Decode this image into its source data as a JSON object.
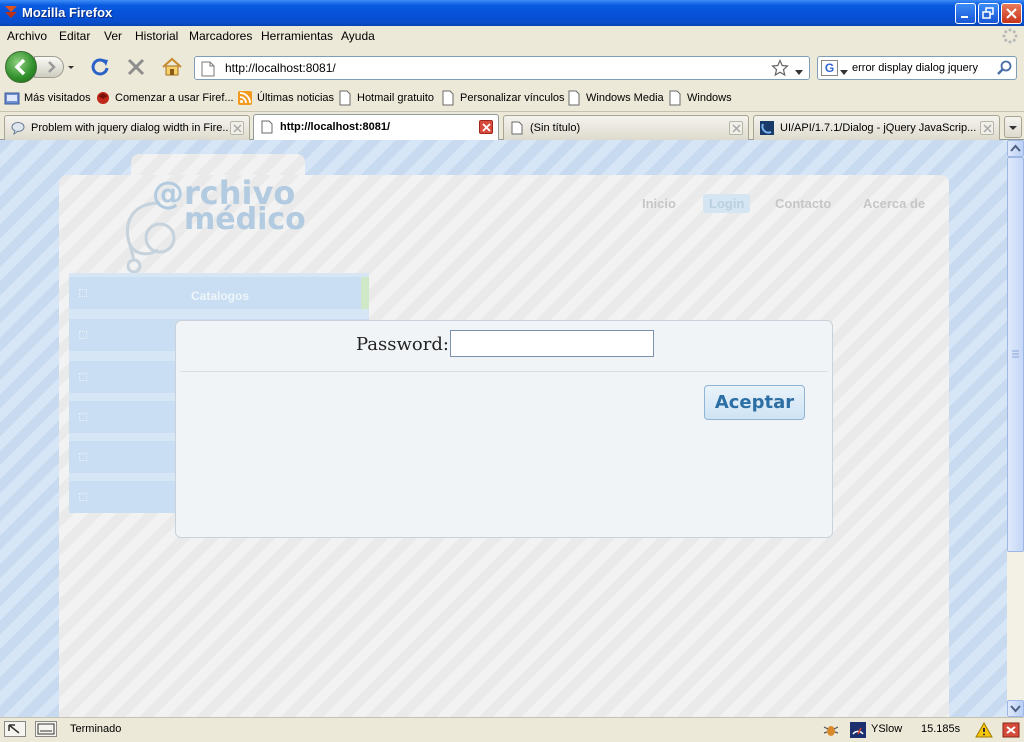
{
  "window": {
    "title": "Mozilla Firefox"
  },
  "menu": {
    "items": [
      "Archivo",
      "Editar",
      "Ver",
      "Historial",
      "Marcadores",
      "Herramientas",
      "Ayuda"
    ]
  },
  "navbar": {
    "url": "http://localhost:8081/",
    "search_value": "error display dialog jquery"
  },
  "bookmarks": {
    "items": [
      "Más visitados",
      "Comenzar a usar Firef...",
      "Últimas noticias",
      "Hotmail gratuito",
      "Personalizar vínculos",
      "Windows Media",
      "Windows"
    ]
  },
  "tabs": [
    {
      "label": "Problem with jquery dialog width in Fire...",
      "active": false
    },
    {
      "label": "http://localhost:8081/",
      "active": true
    },
    {
      "label": "(Sin título)",
      "active": false
    },
    {
      "label": "UI/API/1.7.1/Dialog - jQuery JavaScrip...",
      "active": false
    }
  ],
  "page": {
    "logo_line1": "@rchivo",
    "logo_line2": "médico",
    "nav": [
      "Inicio",
      "Login",
      "Contacto",
      "Acerca de"
    ],
    "active_nav": "Login",
    "side_menu": {
      "first_label": "Catalogos"
    }
  },
  "dialog": {
    "password_label": "Password:",
    "password_value": "",
    "accept_label": "Aceptar"
  },
  "status": {
    "text": "Terminado",
    "yslow": "YSlow",
    "time": "15.185s"
  },
  "colors": {
    "titlebar": "#0550d6",
    "dialog_bg": "#f1f4f7",
    "button_text": "#2c6fa5"
  }
}
